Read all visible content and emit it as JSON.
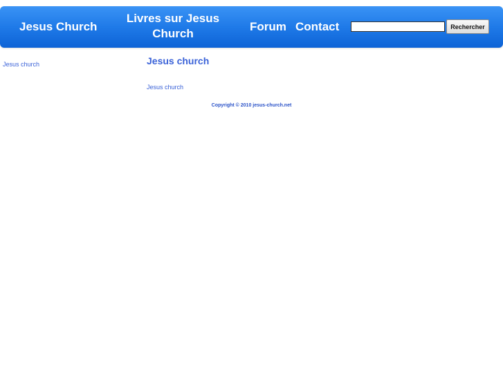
{
  "nav": {
    "home": "Jesus Church",
    "books": "Livres sur Jesus Church",
    "forum": "Forum",
    "contact": "Contact"
  },
  "search": {
    "value": "",
    "button_label": "Rechercher"
  },
  "sidebar": {
    "link": "Jesus church"
  },
  "main": {
    "title": "Jesus church",
    "text": "Jesus church"
  },
  "footer": {
    "copyright": "Copyright © 2010 jesus-church.net"
  },
  "colors": {
    "nav_gradient_top": "#3a93f5",
    "nav_gradient_bottom": "#0d63d6",
    "link": "#3a62d8"
  }
}
